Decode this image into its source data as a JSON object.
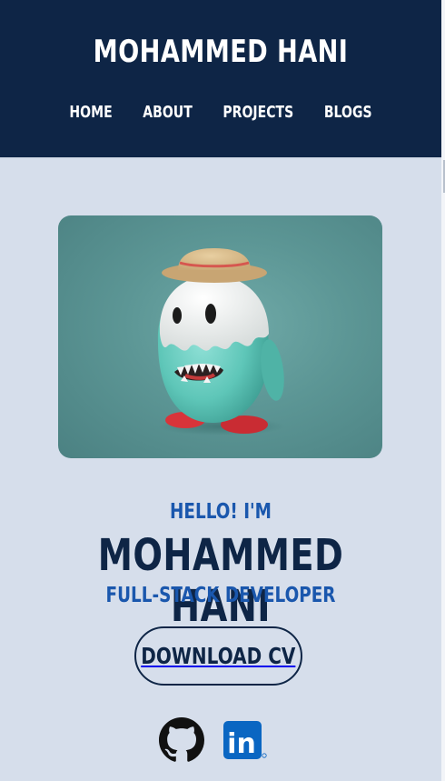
{
  "header": {
    "title": "MOHAMMED HANI",
    "nav": [
      {
        "label": "HOME"
      },
      {
        "label": "ABOUT"
      },
      {
        "label": "PROJECTS"
      },
      {
        "label": "BLOGS"
      }
    ]
  },
  "hero": {
    "greeting": "HELLO! I'M",
    "name": "MOHAMMED HANI",
    "role": "FULL-STACK DEVELOPER",
    "cv_button": "DOWNLOAD CV"
  },
  "social": [
    {
      "icon": "github-icon"
    },
    {
      "icon": "linkedin-icon",
      "label": "in"
    }
  ],
  "colors": {
    "header_bg": "#0e2546",
    "page_bg": "#d6deeb",
    "accent_blue": "#1a57ad",
    "linkedin_blue": "#0a66c2"
  }
}
